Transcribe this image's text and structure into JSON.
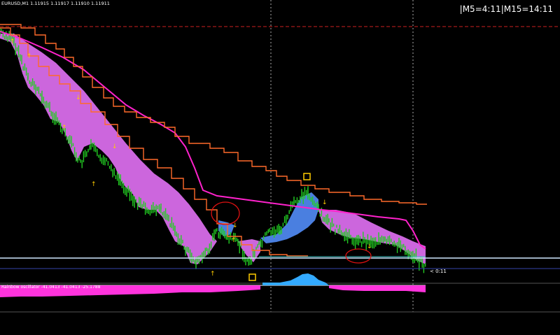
{
  "chart_header": {
    "symbol_label": "EURUSD,M1 1.11915 1.11917 1.11910 1.11911",
    "timer_label": "|M5=4:11|M15=14:11"
  },
  "oscillator": {
    "label": "Rainbow oscillator -41.0413 -41.0413 -25.1788"
  },
  "price_tag": {
    "text": "< 0:11"
  },
  "colors": {
    "background": "#000000",
    "candle": "#22cc22",
    "cloud_bear": "#cc66dd",
    "cloud_bull": "#4a7fe0",
    "ma_line": "#ff22cc",
    "stop_line": "#ff6a2a",
    "level_line": "#cfe8ff",
    "arrow": "#ffcc00",
    "osc_neg": "#ff33dd",
    "osc_pos": "#33aaff"
  },
  "chart_data": {
    "type": "candlestick",
    "indicators": [
      "Rainbow oscillator"
    ],
    "oscillator_values": [
      -41.0413,
      -41.0413,
      -25.1788
    ],
    "grid": false
  }
}
